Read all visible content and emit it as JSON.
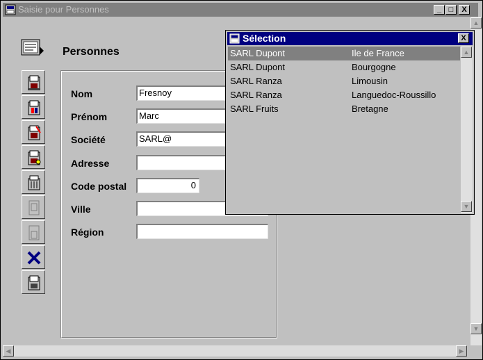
{
  "window": {
    "title": "Saisie pour  Personnes",
    "controls": [
      "_",
      "□",
      "X"
    ]
  },
  "heading": "Personnes",
  "toolbar": {
    "icons": [
      "open-icon",
      "save-icon",
      "edit-icon",
      "print-icon",
      "trash-icon",
      "disabled-page-icon",
      "disabled-page-icon",
      "delete-x-icon",
      "exit-icon"
    ]
  },
  "form": {
    "fields": [
      {
        "label": "Nom",
        "value": "Fresnoy"
      },
      {
        "label": "Prénom",
        "value": "Marc"
      },
      {
        "label": "Société",
        "value": "SARL@"
      },
      {
        "label": "Adresse",
        "value": ""
      },
      {
        "label": "Code postal",
        "value": "0"
      },
      {
        "label": "Ville",
        "value": ""
      },
      {
        "label": "Région",
        "value": ""
      }
    ]
  },
  "popup": {
    "title": "Sélection",
    "close": "X",
    "rows": [
      {
        "company": "SARL Dupont",
        "region": "Ile de France"
      },
      {
        "company": "SARL Dupont",
        "region": "Bourgogne"
      },
      {
        "company": "SARL Ranza",
        "region": "Limousin"
      },
      {
        "company": "SARL Ranza",
        "region": "Languedoc-Roussillo"
      },
      {
        "company": "SARL Fruits",
        "region": "Bretagne"
      }
    ],
    "selected_index": 0
  },
  "colors": {
    "face": "#c0c0c0",
    "active_title": "#000080",
    "inactive_title": "#808080",
    "selection": "#808080"
  }
}
